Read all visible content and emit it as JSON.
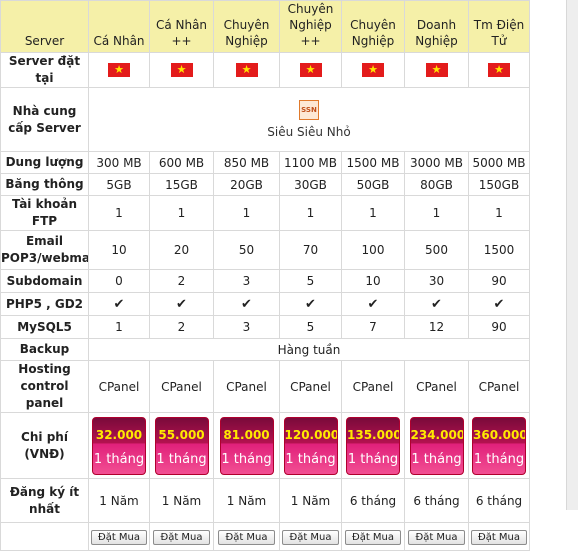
{
  "columns": [
    "Server",
    "Cá Nhân",
    "Cá Nhân ++",
    "Chuyên Nghiệp",
    "Chuyên Nghiệp ++",
    "Chuyên Nghiệp",
    "Doanh Nghiệp",
    "Tm Điện Tử"
  ],
  "rows": {
    "server_location": {
      "label": "Server đặt tại",
      "flag_icon": "vietnam-flag-icon"
    },
    "provider": {
      "label": "Nhà cung cấp Server",
      "logo_text": "SSN",
      "name": "Siêu Siêu Nhỏ"
    },
    "storage": {
      "label": "Dung lượng",
      "values": [
        "300 MB",
        "600 MB",
        "850 MB",
        "1100 MB",
        "1500 MB",
        "3000 MB",
        "5000 MB"
      ]
    },
    "bandwidth": {
      "label": "Băng thông",
      "values": [
        "5GB",
        "15GB",
        "20GB",
        "30GB",
        "50GB",
        "80GB",
        "150GB"
      ]
    },
    "ftp": {
      "label": "Tài khoản FTP",
      "values": [
        "1",
        "1",
        "1",
        "1",
        "1",
        "1",
        "1"
      ]
    },
    "email": {
      "label": "Email POP3/webmail",
      "values": [
        "10",
        "20",
        "50",
        "70",
        "100",
        "500",
        "1500"
      ]
    },
    "subdomain": {
      "label": "Subdomain",
      "values": [
        "0",
        "2",
        "3",
        "5",
        "10",
        "30",
        "90"
      ]
    },
    "php": {
      "label": "PHP5 , GD2",
      "check": "✔"
    },
    "mysql": {
      "label": "MySQL5",
      "values": [
        "1",
        "2",
        "3",
        "5",
        "7",
        "12",
        "90"
      ]
    },
    "backup": {
      "label": "Backup",
      "value": "Hàng tuần"
    },
    "control_panel": {
      "label": "Hosting control panel",
      "values": [
        "CPanel",
        "CPanel",
        "CPanel",
        "CPanel",
        "CPanel",
        "CPanel",
        "CPanel"
      ]
    },
    "price": {
      "label": "Chi phí (VNĐ)",
      "values": [
        "32.000",
        "55.000",
        "81.000",
        "120.000",
        "135.000",
        "234.000",
        "360.000"
      ],
      "period": "1 tháng"
    },
    "min_term": {
      "label": "Đăng ký ít nhất",
      "values": [
        "1 Năm",
        "1 Năm",
        "1 Năm",
        "1 Năm",
        "6 tháng",
        "6 tháng",
        "6 tháng"
      ]
    },
    "order": {
      "button_label": "Đặt Mua"
    }
  },
  "colors": {
    "header_bg": "#f5f0a8",
    "price_box": "#c8145e",
    "price_text": "#ffea00",
    "flag_red": "#e31b1b"
  }
}
